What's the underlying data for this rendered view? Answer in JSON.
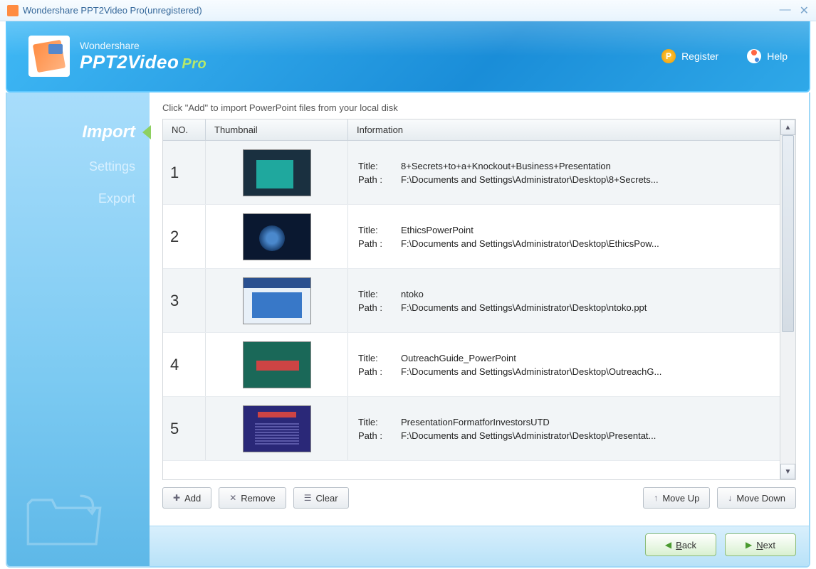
{
  "window": {
    "title": "Wondershare PPT2Video Pro(unregistered)"
  },
  "brand": {
    "company": "Wondershare",
    "product": "PPT2Video",
    "suffix": "Pro"
  },
  "header": {
    "register": "Register",
    "help": "Help"
  },
  "sidebar": {
    "items": [
      {
        "label": "Import",
        "active": true
      },
      {
        "label": "Settings",
        "active": false
      },
      {
        "label": "Export",
        "active": false
      }
    ]
  },
  "main": {
    "instruction": "Click \"Add\" to import PowerPoint files from your local disk",
    "columns": {
      "no": "NO.",
      "thumbnail": "Thumbnail",
      "information": "Information"
    },
    "field_labels": {
      "title": "Title:",
      "path": "Path :"
    },
    "rows": [
      {
        "no": "1",
        "title": "8+Secrets+to+a+Knockout+Business+Presentation",
        "path": "F:\\Documents and Settings\\Administrator\\Desktop\\8+Secrets..."
      },
      {
        "no": "2",
        "title": "EthicsPowerPoint",
        "path": "F:\\Documents and Settings\\Administrator\\Desktop\\EthicsPow..."
      },
      {
        "no": "3",
        "title": "ntoko",
        "path": "F:\\Documents and Settings\\Administrator\\Desktop\\ntoko.ppt"
      },
      {
        "no": "4",
        "title": "OutreachGuide_PowerPoint",
        "path": "F:\\Documents and Settings\\Administrator\\Desktop\\OutreachG..."
      },
      {
        "no": "5",
        "title": "PresentationFormatforInvestorsUTD",
        "path": "F:\\Documents and Settings\\Administrator\\Desktop\\Presentat..."
      }
    ]
  },
  "toolbar": {
    "add": "Add",
    "remove": "Remove",
    "clear": "Clear",
    "moveup": "Move Up",
    "movedown": "Move Down"
  },
  "nav": {
    "back": "Back",
    "next": "Next"
  }
}
